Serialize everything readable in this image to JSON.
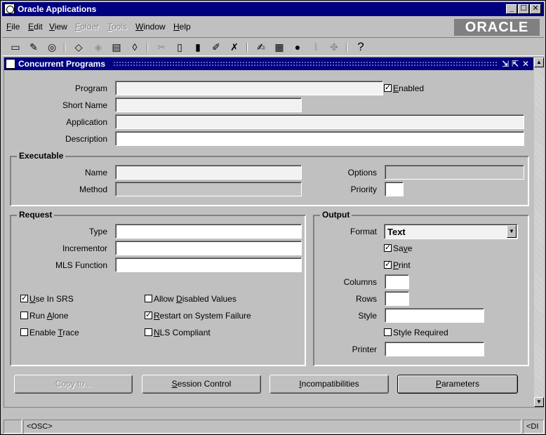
{
  "window": {
    "title": "Oracle Applications",
    "logo": "ORACLE",
    "minimize": "_",
    "maximize": "☐",
    "close": "✕"
  },
  "menu": [
    {
      "key": "F",
      "rest": "ile",
      "enabled": true
    },
    {
      "key": "E",
      "rest": "dit",
      "enabled": true
    },
    {
      "key": "V",
      "rest": "iew",
      "enabled": true
    },
    {
      "key": "F",
      "rest": "older",
      "enabled": false
    },
    {
      "key": "T",
      "rest": "ools",
      "enabled": false
    },
    {
      "key": "W",
      "rest": "indow",
      "enabled": true
    },
    {
      "key": "H",
      "rest": "elp",
      "enabled": true
    }
  ],
  "toolbar": {
    "icons": [
      "new-record-icon",
      "find-icon",
      "navigator-icon",
      "save-icon",
      "print-icon",
      "close-form-icon",
      "cut-icon",
      "copy-icon",
      "paste-icon",
      "clear-record-icon",
      "delete-record-icon",
      "edit-field-icon",
      "zoom-icon",
      "translations-icon",
      "attachments-icon",
      "folder-tools-icon",
      "help-icon"
    ],
    "help_glyph": "?"
  },
  "form": {
    "title": "Concurrent Programs",
    "program_label": "Program",
    "program_value": "",
    "enabled_label": "Enabled",
    "enabled_key": "E",
    "enabled_rest": "nabled",
    "enabled": true,
    "short_name_label": "Short Name",
    "application_label": "Application",
    "description_label": "Description"
  },
  "executable": {
    "title": "Executable",
    "name_label": "Name",
    "method_label": "Method",
    "options_label": "Options",
    "priority_label": "Priority"
  },
  "request": {
    "title": "Request",
    "type_label": "Type",
    "incrementor_label": "Incrementor",
    "mls_label": "MLS Function",
    "checks": {
      "use_in_srs": {
        "pre": "",
        "key": "U",
        "rest": "se In SRS",
        "checked": true
      },
      "run_alone": {
        "pre": "Run ",
        "key": "A",
        "rest": "lone",
        "checked": false
      },
      "enable_trace": {
        "pre": "Enable ",
        "key": "T",
        "rest": "race",
        "checked": false
      },
      "allow_disabled": {
        "pre": "Allow ",
        "key": "D",
        "rest": "isabled Values",
        "checked": false
      },
      "restart": {
        "pre": "",
        "key": "R",
        "rest": "estart on System Failure",
        "checked": true
      },
      "nls": {
        "pre": "",
        "key": "N",
        "rest": "LS Compliant",
        "checked": false
      }
    }
  },
  "output": {
    "title": "Output",
    "format_label": "Format",
    "format_value": "Text",
    "save": {
      "pre": "Sa",
      "key": "v",
      "rest": "e",
      "checked": true
    },
    "print": {
      "pre": "",
      "key": "P",
      "rest": "rint",
      "checked": true
    },
    "columns_label": "Columns",
    "rows_label": "Rows",
    "style_label": "Style",
    "style_required": {
      "pre": "Style Required",
      "key": "",
      "rest": "",
      "checked": false
    },
    "printer_label": "Printer"
  },
  "buttons": {
    "copy_to": "Copy to...",
    "session_control_key": "S",
    "session_control_rest": "ession Control",
    "incompatibilities_key": "I",
    "incompatibilities_rest": "ncompatibilities",
    "parameters_key": "P",
    "parameters_rest": "arameters"
  },
  "status": {
    "left": "<OSC>",
    "right": "<DI"
  }
}
